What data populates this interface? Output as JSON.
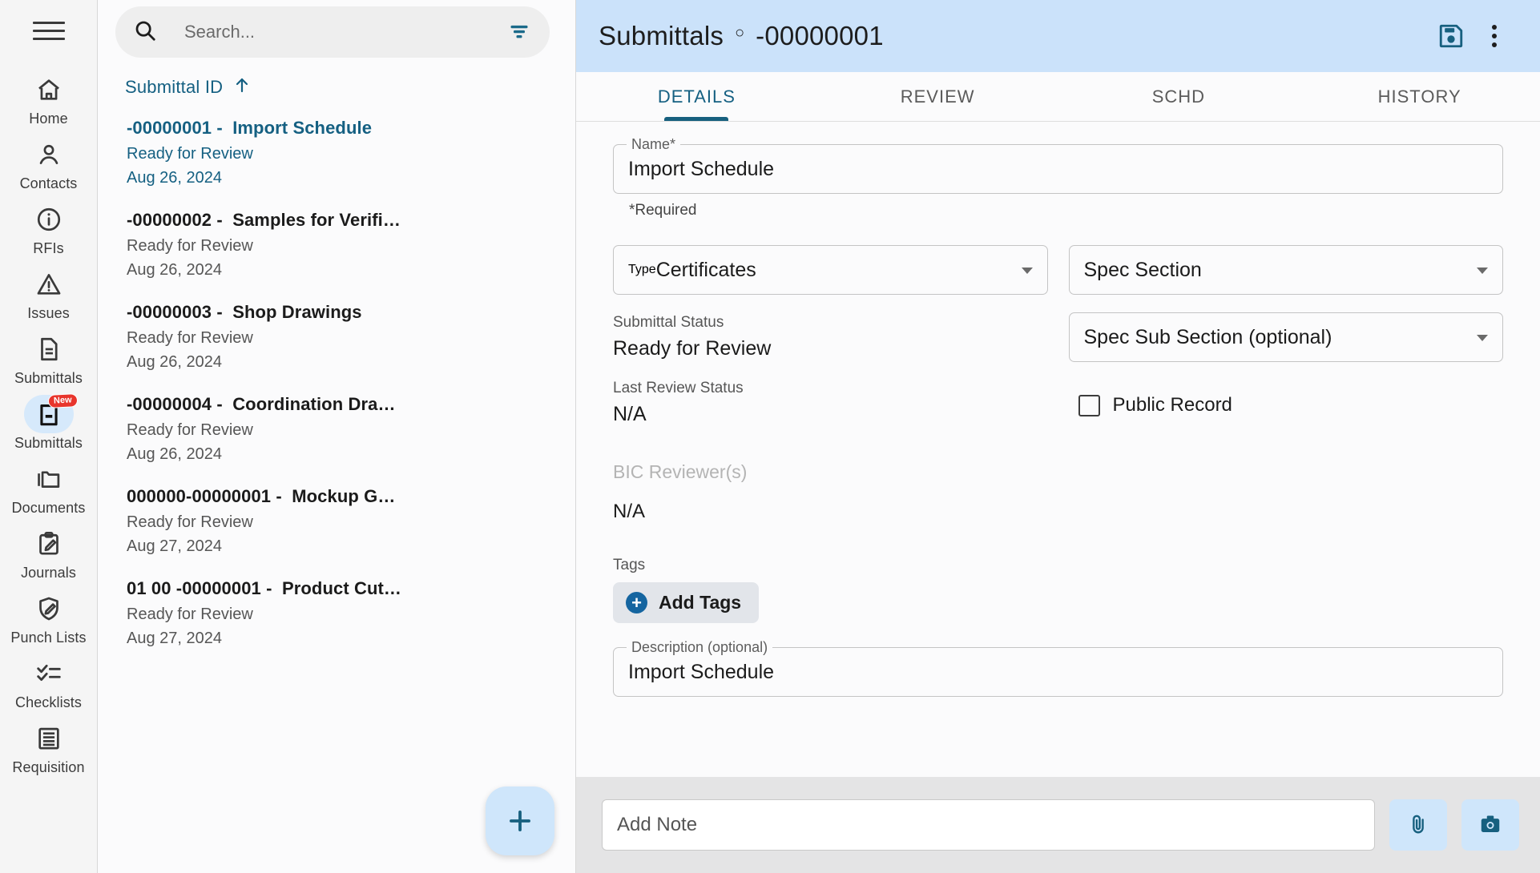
{
  "sidebar": {
    "menu_icon": "hamburger-menu-icon",
    "items": [
      {
        "label": "Home",
        "icon": "home-icon",
        "active": false,
        "badge": ""
      },
      {
        "label": "Contacts",
        "icon": "person-icon",
        "active": false,
        "badge": ""
      },
      {
        "label": "RFIs",
        "icon": "info-circle-icon",
        "active": false,
        "badge": ""
      },
      {
        "label": "Issues",
        "icon": "warning-triangle-icon",
        "active": false,
        "badge": ""
      },
      {
        "label": "Submittals",
        "icon": "document-icon",
        "active": false,
        "badge": ""
      },
      {
        "label": "Submittals",
        "icon": "submittal-new-icon",
        "active": true,
        "badge": "New"
      },
      {
        "label": "Documents",
        "icon": "folders-icon",
        "active": false,
        "badge": ""
      },
      {
        "label": "Journals",
        "icon": "clipboard-pencil-icon",
        "active": false,
        "badge": ""
      },
      {
        "label": "Punch Lists",
        "icon": "shield-pencil-icon",
        "active": false,
        "badge": ""
      },
      {
        "label": "Checklists",
        "icon": "checklist-icon",
        "active": false,
        "badge": ""
      },
      {
        "label": "Requisition",
        "icon": "ledger-icon",
        "active": false,
        "badge": ""
      }
    ]
  },
  "list_panel": {
    "search": {
      "placeholder": "Search...",
      "value": "",
      "icon": "search-icon",
      "filter_icon": "filter-icon"
    },
    "sort": {
      "label": "Submittal ID",
      "direction_icon": "arrow-up-icon"
    },
    "items": [
      {
        "id": "-00000001 -",
        "title": "Import Schedule",
        "status": "Ready for Review",
        "date": "Aug 26, 2024",
        "selected": true
      },
      {
        "id": "-00000002 -",
        "title": "Samples for Verifi…",
        "status": "Ready for Review",
        "date": "Aug 26, 2024",
        "selected": false
      },
      {
        "id": "-00000003 -",
        "title": "Shop Drawings",
        "status": "Ready for Review",
        "date": "Aug 26, 2024",
        "selected": false
      },
      {
        "id": "-00000004 -",
        "title": "Coordination Dra…",
        "status": "Ready for Review",
        "date": "Aug 26, 2024",
        "selected": false
      },
      {
        "id": "000000-00000001 -",
        "title": "Mockup G…",
        "status": "Ready for Review",
        "date": "Aug 27, 2024",
        "selected": false
      },
      {
        "id": "01 00 -00000001 -",
        "title": "Product Cut…",
        "status": "Ready for Review",
        "date": "Aug 27, 2024",
        "selected": false
      }
    ],
    "fab": {
      "label": "+",
      "icon": "plus-icon"
    }
  },
  "detail": {
    "header": {
      "breadcrumb_root": "Submittals",
      "breadcrumb_separator": "○",
      "breadcrumb_id": "-00000001",
      "save_icon": "save-floppy-icon",
      "more_icon": "more-vertical-icon",
      "background": "#cbe2fa"
    },
    "tabs": [
      {
        "label": "DETAILS",
        "active": true
      },
      {
        "label": "REVIEW",
        "active": false
      },
      {
        "label": "SCHD",
        "active": false
      },
      {
        "label": "HISTORY",
        "active": false
      }
    ],
    "accent_color": "#17607f",
    "form": {
      "name": {
        "legend": "Name*",
        "value": "Import Schedule"
      },
      "required_note": "*Required",
      "type": {
        "legend": "Type",
        "value": "Certificates"
      },
      "spec_section": {
        "value": "Spec Section"
      },
      "spec_sub_section": {
        "value": "Spec Sub Section (optional)"
      },
      "submittal_status": {
        "label": "Submittal Status",
        "value": "Ready for Review"
      },
      "last_review_status": {
        "label": "Last Review Status",
        "value": "N/A"
      },
      "public_record": {
        "label": "Public Record",
        "checked": false
      },
      "bic_reviewers": {
        "label": "BIC Reviewer(s)",
        "value": "N/A"
      },
      "tags": {
        "label": "Tags",
        "button_label": "Add Tags",
        "button_icon": "plus-circle-icon"
      },
      "description": {
        "legend": "Description (optional)",
        "value": "Import Schedule"
      }
    },
    "note_bar": {
      "note_placeholder": "Add Note",
      "note_value": "",
      "attach_icon": "paperclip-icon",
      "camera_icon": "camera-icon"
    }
  }
}
